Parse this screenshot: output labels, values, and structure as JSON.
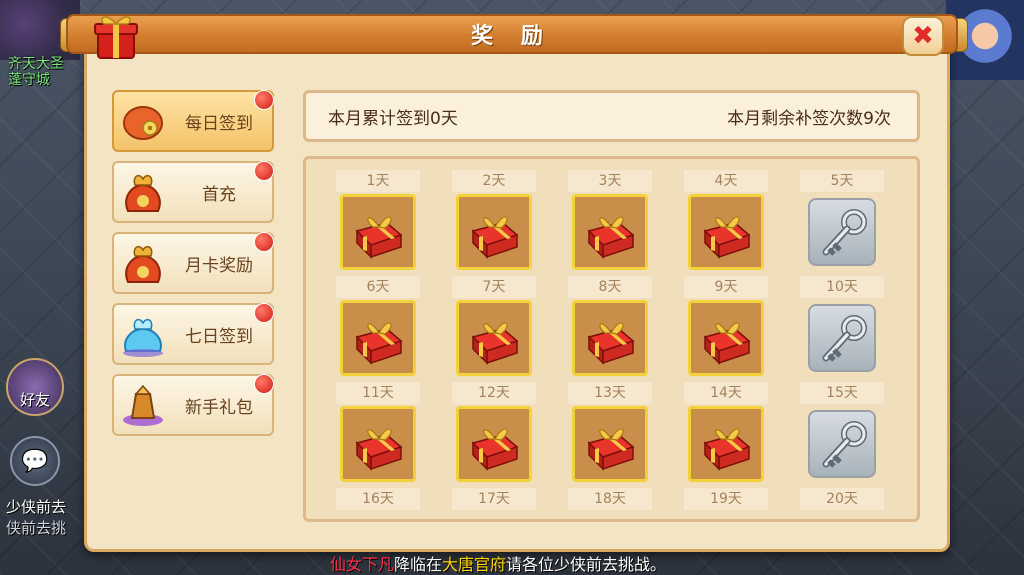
{
  "dialog": {
    "title": "奖 励",
    "close_icon": "close-icon"
  },
  "tabs": [
    {
      "label": "每日签到",
      "icon": "coin-pouch-icon",
      "active": true,
      "badge": true
    },
    {
      "label": "首充",
      "icon": "money-bag-icon",
      "active": false,
      "badge": true
    },
    {
      "label": "月卡奖励",
      "icon": "money-bag-icon",
      "active": false,
      "badge": true
    },
    {
      "label": "七日签到",
      "icon": "crystal-bag-icon",
      "active": false,
      "badge": true
    },
    {
      "label": "新手礼包",
      "icon": "treasure-icon",
      "active": false,
      "badge": true
    }
  ],
  "info": {
    "signed_text": "本月累计签到0天",
    "remaining_text": "本月剩余补签次数9次"
  },
  "calendar": {
    "day_labels": [
      "1天",
      "2天",
      "3天",
      "4天",
      "5天",
      "6天",
      "7天",
      "8天",
      "9天",
      "10天",
      "11天",
      "12天",
      "13天",
      "14天",
      "15天",
      "16天",
      "17天",
      "18天",
      "19天",
      "20天"
    ],
    "rows": [
      {
        "items": [
          "gift",
          "gift",
          "gift",
          "gift",
          "key"
        ]
      },
      {
        "items": [
          "gift",
          "gift",
          "gift",
          "gift",
          "key"
        ]
      },
      {
        "items": [
          "gift",
          "gift",
          "gift",
          "gift",
          "key"
        ]
      }
    ]
  },
  "background": {
    "player_name_line1": "齐天大圣",
    "player_name_line2": "蓬守城",
    "friend_label": "好友",
    "chat_line1": "少侠前去",
    "chat_line2": "侠前去挑"
  },
  "marquee": {
    "part1": "仙女下凡",
    "part2": "降临在",
    "part3": "大唐官府",
    "part4": "请各位少侠前去挑战。"
  },
  "colors": {
    "title_bar": "#d37e2e",
    "badge_red": "#d31a12",
    "gift_border": "#f2d13b",
    "marquee_red": "#ff2e4a",
    "marquee_yellow": "#ffd400"
  }
}
